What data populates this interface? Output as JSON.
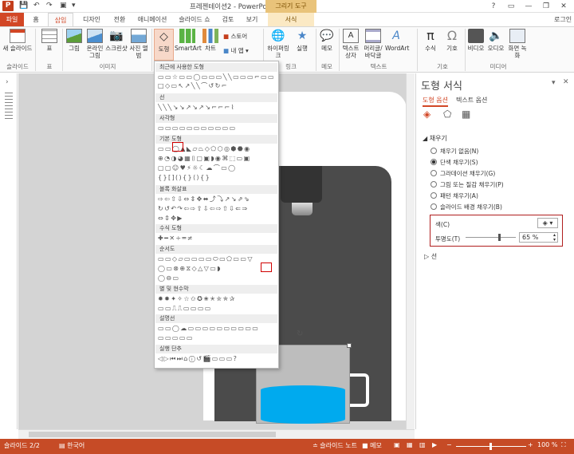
{
  "app": {
    "doc_title": "프레젠테이션2 - PowerPoint",
    "context_tab_group": "그리기 도구",
    "window_controls": [
      "?",
      "▭",
      "—",
      "❐",
      "✕"
    ],
    "signin": "로그인"
  },
  "tabs": [
    "파일",
    "홈",
    "삽입",
    "디자인",
    "전환",
    "애니메이션",
    "슬라이드 쇼",
    "검토",
    "보기",
    "서식"
  ],
  "ribbon": {
    "buttons": [
      "새 슬라이드",
      "표",
      "그림",
      "온라인 그림",
      "스크린샷",
      "사진 앨범",
      "도형",
      "SmartArt",
      "차트",
      "하이퍼링크",
      "실행",
      "메모",
      "텍스트 상자",
      "머리글/바닥글",
      "WordArt",
      "수식",
      "기호",
      "비디오",
      "오디오",
      "화면 녹화"
    ],
    "store": "스토어",
    "myapps": "내 앱",
    "groups": [
      "슬라이드",
      "표",
      "이미지",
      "링크",
      "메모",
      "텍스트",
      "기호",
      "미디어"
    ]
  },
  "shapes_menu": {
    "categories": [
      "최근에 사용한 도형",
      "선",
      "사각형",
      "기본 도형",
      "블록 화살표",
      "수식 도형",
      "순서도",
      "별 및 현수막",
      "설명선",
      "실행 단추"
    ],
    "rows": {
      "recent": [
        "▭▭☆▭▭◯▭▭▭╲╲▭▭▭⌐▭▭",
        "□◇▭↖↗╲╲⌒↺↻⌐"
      ],
      "lines": [
        "╲╲╲↘↘↗↘↗↘⌐⌐⌐⌇"
      ],
      "rects": [
        "▭▭▭▭▭▭▭▭▭▭▭"
      ],
      "basic": [
        "▭▭◯▲◣▱⏢◇⬠⬡◎⬢⬣◉",
        "⊕◔◑◕▦⌷▢▣◗◉⌘⬚▭▣",
        "▢▢☺♥⚡☼☾☁⌒▭◯",
        "{}[](){}⟨⟩{}"
      ],
      "block": [
        "⇨⇦⇧⇩⇔⇕✥⬌⤴⤵↗↘⇗⇘",
        "↻↺↶↷⇦⇨⇧⇩⇦⇨⇧⇩⇐⇒",
        "⇔⇕✥▶"
      ],
      "math": [
        "✚━✕÷═≠"
      ],
      "flow": [
        "▭▭◇▱▭▭▭▭⬭▭⬠▭▭▽",
        "◯▭⊗⊕⧖◇△▽▭◗",
        "◯⊖▭"
      ],
      "stars": [
        "✹✸✦✧☆✩✪✬✭✮✯✰",
        "▭▭⎍⎍▭▭▭▭"
      ],
      "callouts": [
        "▭▭◯☁▭▭▭▭▭▭▭▭▭▭",
        "▭▭▭▭▭"
      ],
      "action": [
        "◁▷⏮⏭⌂ⓘ↺🎬▭▭▭?"
      ]
    }
  },
  "pane": {
    "title": "도형 서식",
    "tabs": [
      "도형 옵션",
      "텍스트 옵션"
    ],
    "section_fill": "채우기",
    "fill_options": [
      "채우기 없음(N)",
      "단색 채우기(S)",
      "그라데이션 채우기(G)",
      "그림 또는 질감 채우기(P)",
      "패턴 채우기(A)",
      "슬라이드 배경 채우기(B)"
    ],
    "selected_fill": 1,
    "color_label": "색(C)",
    "transparency_label": "투명도(T)",
    "transparency_value": "65 %",
    "transparency_fraction": 0.65,
    "section_line": "선",
    "close": "✕",
    "pin": "▾"
  },
  "status": {
    "slide": "슬라이드 2/2",
    "lang": "한국어",
    "notes": "슬라이드 노트",
    "memo": "메모",
    "zoom": "100 %"
  },
  "colors": {
    "accent": "#d24726",
    "status_bg": "#c64b26",
    "water": "#00aaee"
  }
}
